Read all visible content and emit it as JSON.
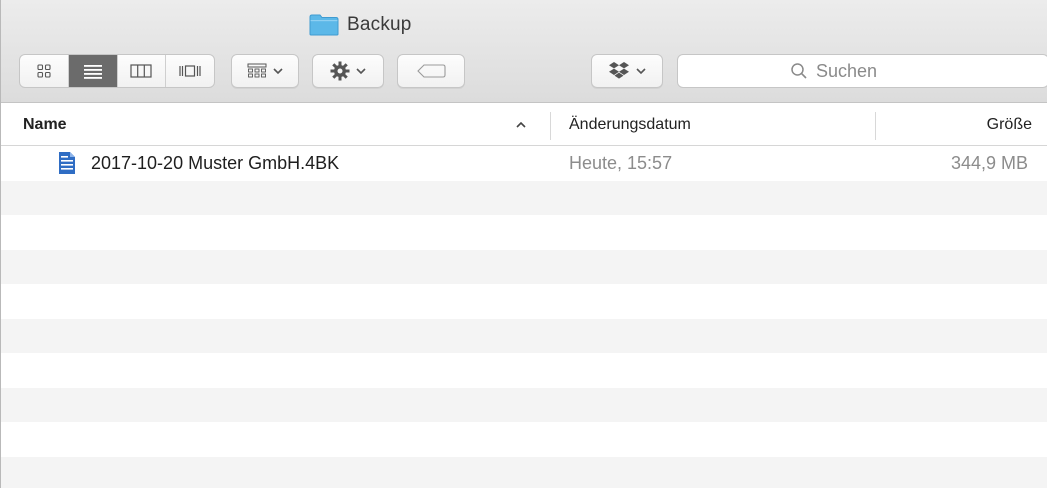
{
  "window": {
    "title": "Backup"
  },
  "toolbar": {
    "view_modes": [
      "icon-view",
      "list-view",
      "column-view",
      "cover-flow-view"
    ],
    "active_view": "list-view",
    "search": {
      "placeholder": "Suchen"
    }
  },
  "columns": {
    "name": "Name",
    "sort_indicator": "^",
    "date": "Änderungsdatum",
    "size": "Größe"
  },
  "files": [
    {
      "name": "2017-10-20 Muster GmbH.4BK",
      "modified": "Heute, 15:57",
      "size": "344,9 MB",
      "icon": "document-icon"
    }
  ],
  "colors": {
    "folder": "#5cb8e8",
    "document_icon": "#2f6dc4",
    "stripe": "#f4f4f4",
    "active_segment": "#6b6b6b"
  }
}
